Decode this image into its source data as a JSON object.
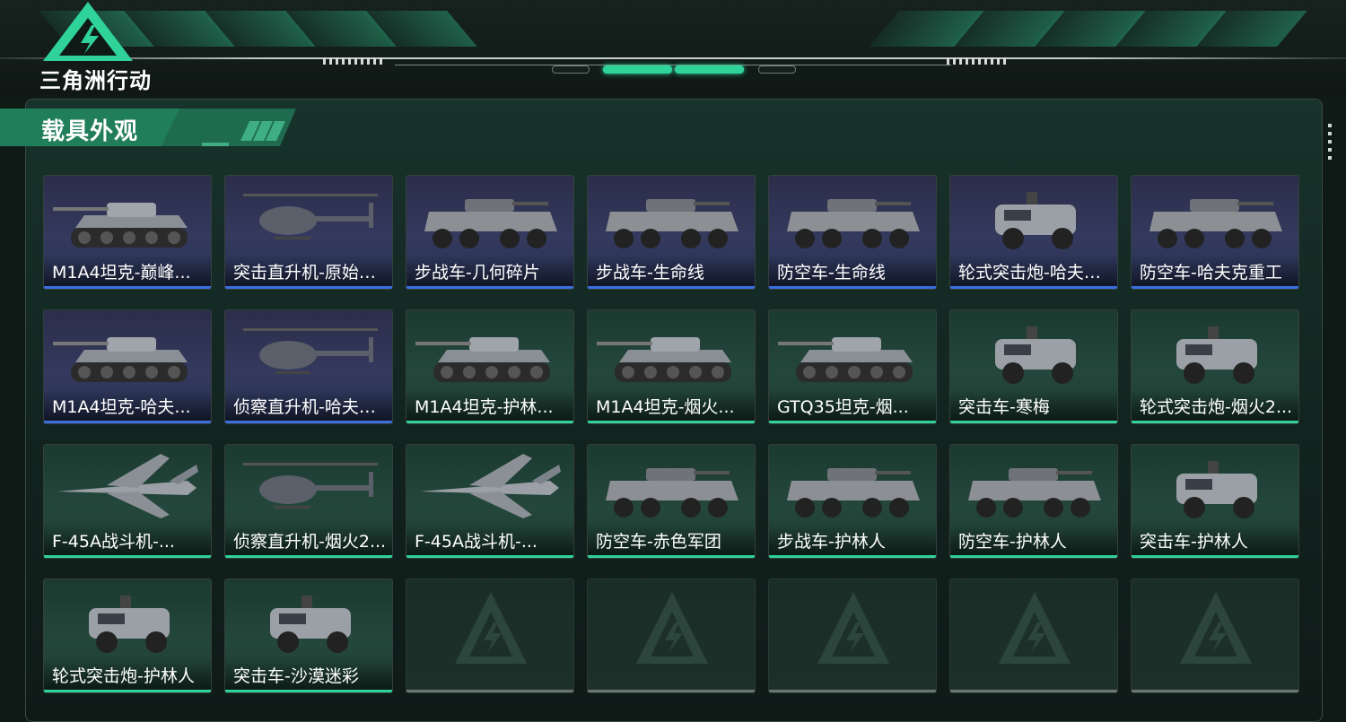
{
  "app": {
    "logo_text": "三角洲行动",
    "colors": {
      "accent": "#2fd39a",
      "rare_blue": "#3a6fe0",
      "locked_grey": "#6d7572"
    }
  },
  "section": {
    "title": "载具外观"
  },
  "vehicles": [
    {
      "name": "M1A4坦克-巅峰...",
      "rarity": "blue",
      "kind": "tank"
    },
    {
      "name": "突击直升机-原始伪...",
      "rarity": "blue",
      "kind": "heli"
    },
    {
      "name": "步战车-几何碎片",
      "rarity": "blue",
      "kind": "apc"
    },
    {
      "name": "步战车-生命线",
      "rarity": "blue",
      "kind": "apc"
    },
    {
      "name": "防空车-生命线",
      "rarity": "blue",
      "kind": "apc"
    },
    {
      "name": "轮式突击炮-哈夫克...",
      "rarity": "blue",
      "kind": "truck"
    },
    {
      "name": "防空车-哈夫克重工",
      "rarity": "blue",
      "kind": "apc"
    },
    {
      "name": "M1A4坦克-哈夫...",
      "rarity": "blue",
      "kind": "tank"
    },
    {
      "name": "侦察直升机-哈夫克...",
      "rarity": "blue",
      "kind": "heli"
    },
    {
      "name": "M1A4坦克-护林...",
      "rarity": "green",
      "kind": "tank"
    },
    {
      "name": "M1A4坦克-烟火...",
      "rarity": "green",
      "kind": "tank"
    },
    {
      "name": "GTQ35坦克-烟...",
      "rarity": "green",
      "kind": "tank"
    },
    {
      "name": "突击车-寒梅",
      "rarity": "green",
      "kind": "truck"
    },
    {
      "name": "轮式突击炮-烟火2...",
      "rarity": "green",
      "kind": "truck"
    },
    {
      "name": "F-45A战斗机-...",
      "rarity": "green",
      "kind": "jet"
    },
    {
      "name": "侦察直升机-烟火2...",
      "rarity": "green",
      "kind": "heli"
    },
    {
      "name": "F-45A战斗机-...",
      "rarity": "green",
      "kind": "jet"
    },
    {
      "name": "防空车-赤色军团",
      "rarity": "green",
      "kind": "apc"
    },
    {
      "name": "步战车-护林人",
      "rarity": "green",
      "kind": "apc"
    },
    {
      "name": "防空车-护林人",
      "rarity": "green",
      "kind": "apc"
    },
    {
      "name": "突击车-护林人",
      "rarity": "green",
      "kind": "truck"
    },
    {
      "name": "轮式突击炮-护林人",
      "rarity": "green",
      "kind": "truck"
    },
    {
      "name": "突击车-沙漠迷彩",
      "rarity": "green",
      "kind": "truck"
    },
    {
      "name": "",
      "rarity": "empty",
      "kind": "empty"
    },
    {
      "name": "",
      "rarity": "empty",
      "kind": "empty"
    },
    {
      "name": "",
      "rarity": "empty",
      "kind": "empty"
    },
    {
      "name": "",
      "rarity": "empty",
      "kind": "empty"
    },
    {
      "name": "",
      "rarity": "empty",
      "kind": "empty"
    }
  ]
}
